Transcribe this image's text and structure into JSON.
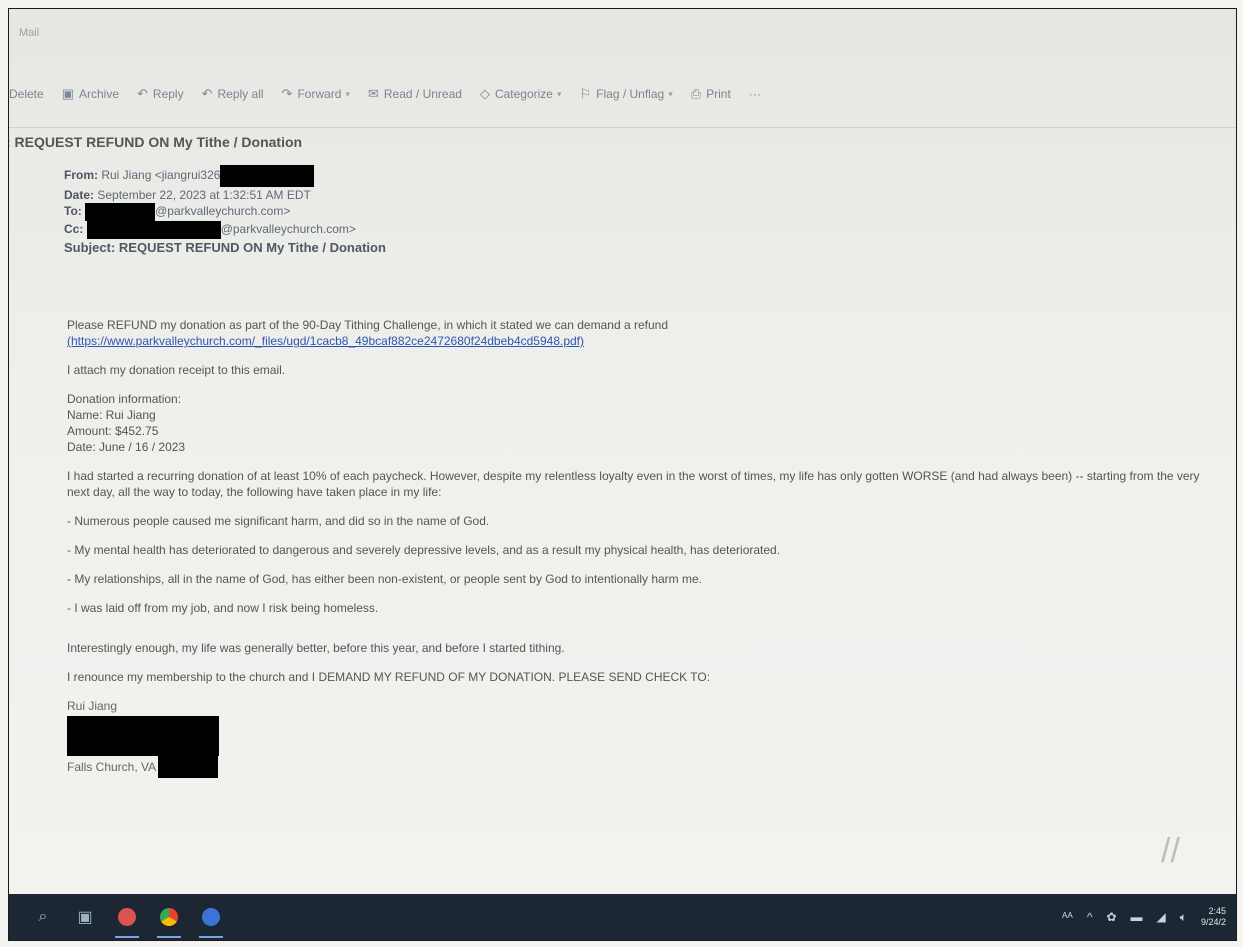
{
  "app": {
    "title": "Mail"
  },
  "toolbar": {
    "items": [
      {
        "label": "Delete",
        "icon": "trash-icon"
      },
      {
        "label": "Archive",
        "icon": "archive-icon"
      },
      {
        "label": "Reply",
        "icon": "reply-icon"
      },
      {
        "label": "Reply all",
        "icon": "reply-all-icon"
      },
      {
        "label": "Forward",
        "icon": "forward-icon",
        "dropdown": true
      },
      {
        "label": "Read / Unread",
        "icon": "envelope-icon"
      },
      {
        "label": "Categorize",
        "icon": "tag-icon",
        "dropdown": true
      },
      {
        "label": "Flag / Unflag",
        "icon": "flag-icon",
        "dropdown": true
      },
      {
        "label": "Print",
        "icon": "print-icon"
      },
      {
        "label": "···",
        "icon": "more-icon"
      }
    ]
  },
  "message": {
    "subject_bar": ": REQUEST REFUND ON My Tithe / Donation",
    "from_label": "From:",
    "from_value": "Rui Jiang <jiangrui326",
    "date_label": "Date:",
    "date_value": "September 22, 2023 at 1:32:51 AM EDT",
    "to_label": "To:",
    "to_value": "@parkvalleychurch.com>",
    "cc_label": "Cc:",
    "cc_value": "@parkvalleychurch.com>",
    "subject_label": "Subject:",
    "subject_value": "REQUEST REFUND ON My Tithe / Donation"
  },
  "body": {
    "p1": "Please REFUND my donation as part of the 90-Day Tithing Challenge, in which it stated we can demand a refund",
    "p1_link": "(https://www.parkvalleychurch.com/_files/ugd/1cacb8_49bcaf882ce2472680f24dbeb4cd5948.pdf)",
    "p2": "I attach my donation receipt to this email.",
    "info_title": "Donation information:",
    "info_name": "Name: Rui Jiang",
    "info_amount": "Amount: $452.75",
    "info_date": "Date: June / 16 / 2023",
    "p3": "I had started a recurring donation of at least 10% of each paycheck.  However, despite my relentless loyalty even in the worst of times, my life has only gotten WORSE (and had always been)  -- starting from the very next day, all the way to today, the following have taken place in my life:",
    "b1": "- Numerous people caused me significant harm, and did so in the name of God.",
    "b2": "- My mental health has deteriorated to dangerous and severely depressive levels, and as a result my physical health, has deteriorated.",
    "b3": "- My relationships, all in the name of God, has either been non-existent, or people sent by God to intentionally harm me.",
    "b4": "- I was laid off from my job, and now I risk being homeless.",
    "p4": "Interestingly enough, my life was generally better, before this year, and before I started tithing.",
    "p5": "I renounce my membership to the church and I DEMAND MY REFUND OF MY DONATION. PLEASE SEND CHECK TO:",
    "sig_name": "Rui Jiang",
    "sig_city": "Falls Church, VA"
  },
  "taskbar": {
    "clock_time": "2:45",
    "clock_date": "9/24/2"
  },
  "colors": {
    "taskbar_bg": "#1d2733",
    "link": "#2f55b5",
    "redaction": "#000000"
  }
}
